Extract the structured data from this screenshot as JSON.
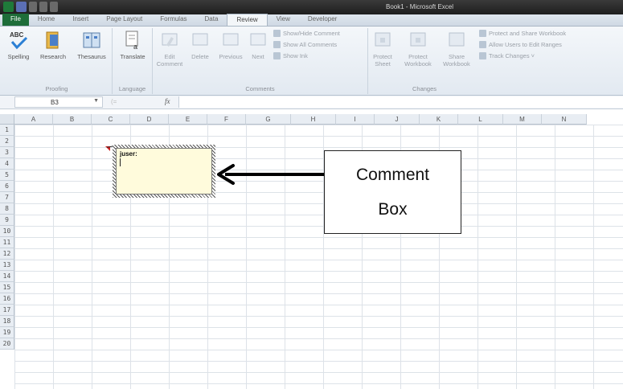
{
  "window": {
    "title": "Book1 - Microsoft Excel"
  },
  "tabs": [
    "File",
    "Home",
    "Insert",
    "Page Layout",
    "Formulas",
    "Data",
    "Review",
    "View",
    "Developer"
  ],
  "active_tab": "Review",
  "ribbon": {
    "proofing": {
      "label": "Proofing",
      "spelling": "Spelling",
      "research": "Research",
      "thesaurus": "Thesaurus"
    },
    "language": {
      "label": "Language",
      "translate": "Translate"
    },
    "comments": {
      "label": "Comments",
      "edit_comment_1": "Edit",
      "edit_comment_2": "Comment",
      "delete": "Delete",
      "previous": "Previous",
      "next": "Next",
      "show_hide": "Show/Hide Comment",
      "show_all": "Show All Comments",
      "show_ink": "Show Ink"
    },
    "changes": {
      "label": "Changes",
      "protect_sheet_1": "Protect",
      "protect_sheet_2": "Sheet",
      "protect_workbook_1": "Protect",
      "protect_workbook_2": "Workbook",
      "share_workbook_1": "Share",
      "share_workbook_2": "Workbook",
      "protect_share": "Protect and Share Workbook",
      "allow_users": "Allow Users to Edit Ranges",
      "track_changes": "Track Changes ˅"
    }
  },
  "formula_bar": {
    "name_box": "B3",
    "fx": "fx",
    "value": ""
  },
  "columns": [
    "A",
    "B",
    "C",
    "D",
    "E",
    "F",
    "G",
    "H",
    "I",
    "J",
    "K",
    "L",
    "M",
    "N"
  ],
  "rows": [
    "1",
    "2",
    "3",
    "4",
    "5",
    "6",
    "7",
    "8",
    "9",
    "10",
    "11",
    "12",
    "13",
    "14",
    "15",
    "16",
    "17",
    "18",
    "19",
    "20"
  ],
  "comment": {
    "author": "juser:"
  },
  "callout": {
    "line1": "Comment",
    "line2": "Box"
  },
  "colors": {
    "file_tab": "#1e6d39",
    "comment_fill": "#fffbdc",
    "comment_marker": "#d02020"
  }
}
